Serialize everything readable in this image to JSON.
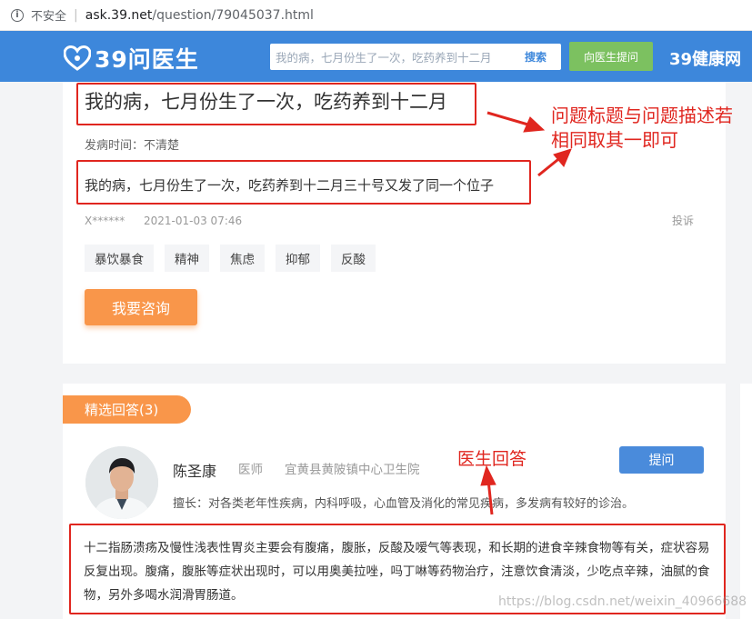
{
  "browser": {
    "security_label": "不安全",
    "url_host": "ask.39.net",
    "url_path": "/question/79045037.html"
  },
  "header": {
    "logo_text": "39问医生",
    "search_placeholder": "我的病，七月份生了一次，吃药养到十二月",
    "search_button": "搜索",
    "ask_doctor_button": "向医生提问",
    "brand": "39健康网"
  },
  "question": {
    "title": "我的病，七月份生了一次，吃药养到十二月",
    "onset_time": "发病时间：不清楚",
    "description": "我的病，七月份生了一次，吃药养到十二月三十号又发了同一个位子",
    "user": "X******",
    "date": "2021-01-03 07:46",
    "report": "投诉",
    "tags": [
      "暴饮暴食",
      "精神",
      "焦虑",
      "抑郁",
      "反酸"
    ],
    "consult_button": "我要咨询"
  },
  "answers": {
    "tab_label": "精选回答(3)",
    "doctor": {
      "name": "陈圣康",
      "role": "医师",
      "hospital": "宜黄县黄陂镇中心卫生院",
      "specialty": "擅长：对各类老年性疾病，内科呼吸，心血管及消化的常见疾病，多发病有较好的诊治。",
      "ask_button": "提问"
    },
    "answer_text": "十二指肠溃疡及慢性浅表性胃炎主要会有腹痛，腹胀，反酸及嗳气等表现，和长期的进食辛辣食物等有关，症状容易反复出现。腹痛，腹胀等症状出现时，可以用奥美拉唑，吗丁啉等药物治疗，注意饮食清淡，少吃点辛辣，油腻的食物，另外多喝水润滑胃肠道。"
  },
  "annotations": {
    "note_line1": "问题标题与问题描述若",
    "note_line2": "相同取其一即可",
    "doctor_answer_note": "医生回答",
    "color": "#e0261f"
  },
  "watermark": "https://blog.csdn.net/weixin_40966688"
}
